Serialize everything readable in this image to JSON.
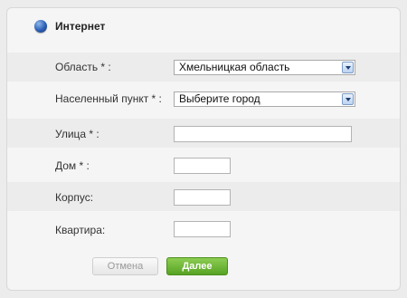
{
  "header": {
    "title": "Интернет",
    "icon": "globe-icon"
  },
  "form": {
    "region": {
      "label": "Область * :",
      "value": "Хмельницкая область"
    },
    "locality": {
      "label": "Населенный пункт * :",
      "value": "Выберите город"
    },
    "street": {
      "label": "Улица * :",
      "value": ""
    },
    "house": {
      "label": "Дом * :",
      "value": ""
    },
    "building": {
      "label": "Корпус:",
      "value": ""
    },
    "apartment": {
      "label": "Квартира:",
      "value": ""
    }
  },
  "actions": {
    "cancel_label": "Отмена",
    "next_label": "Далее"
  },
  "colors": {
    "accent": "#6bbb35"
  }
}
